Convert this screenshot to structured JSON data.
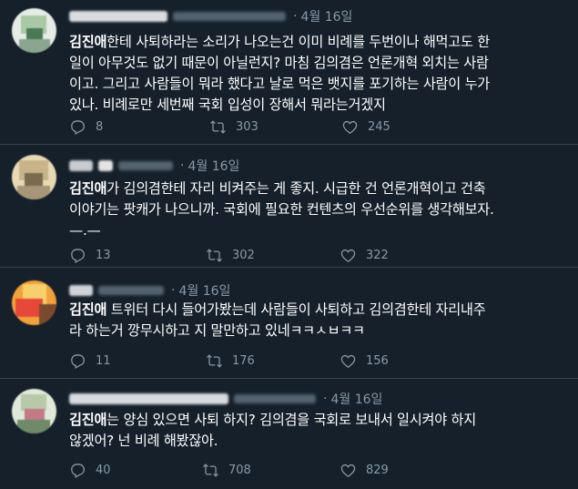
{
  "tweets": [
    {
      "date": "4월 16일",
      "name_color": "#d9dde0",
      "avatar_colors": [
        "#e6ebe6",
        "#a9c9a4",
        "#4a7a55",
        "#f0e9e2",
        "#8aa68e"
      ],
      "highlight": "김진애",
      "lines": [
        "한테 사퇴하라는 소리가 나오는건 이미 비례를 두번이나 해먹고도 한",
        "일이 아무것도 없기 때문이 아닐런지? 마침 김의겸은 언론개혁 외치는 사람",
        "이고. 그리고 사람들이 뭐라 했다고 날로 먹은 뱃지를 포기하는 사람이 누가",
        "있나. 비례로만 세번째 국회 입성이 장해서 뭐라는거겠지"
      ],
      "replies": "8",
      "retweets": "303",
      "likes": "245"
    },
    {
      "date": "4월 16일",
      "name_color": "#c8ccd0",
      "avatar_colors": [
        "#e8d9b5",
        "#c9b489",
        "#7a6a4e",
        "#f2e8d2",
        "#a89678"
      ],
      "highlight": "김진애",
      "lines": [
        "가 김의겸한테 자리 비켜주는 게 좋지. 시급한 건 언론개혁이고 건축",
        "이야기는 팟캐가 나으니까. 국회에 필요한 컨텐츠의 우선순위를 생각해보자.",
        "—.—"
      ],
      "replies": "13",
      "retweets": "302",
      "likes": "322"
    },
    {
      "date": "4월 16일",
      "name_color": "#d0d4d8",
      "avatar_colors": [
        "#f2a23a",
        "#e7483a",
        "#7a4a2e",
        "#f6d06a",
        "#c94b35"
      ],
      "highlight": "김진애",
      "lines": [
        " 트위터 다시 들어가봤는데 사람들이 사퇴하고 김의겸한테 자리내주",
        "라 하는거 깡무시하고 지 말만하고 있네ㅋㅋㅅㅂㅋㅋ"
      ],
      "replies": "11",
      "retweets": "176",
      "likes": "156"
    },
    {
      "date": "4월 16일",
      "name_color": "#d7dbdf",
      "avatar_colors": [
        "#dfe8d9",
        "#b7c9a8",
        "#6f8a67",
        "#e7dbd6",
        "#c27a84"
      ],
      "highlight": "김진애",
      "lines": [
        "는 양심 있으면 사퇴 하지? 김의겸을 국회로 보내서 일시켜야 하지",
        "않겠어? 넌 비례 해봤잖아."
      ],
      "replies": "40",
      "retweets": "708",
      "likes": "829"
    }
  ],
  "icons": {
    "reply": "reply-icon",
    "retweet": "retweet-icon",
    "like": "like-icon"
  }
}
